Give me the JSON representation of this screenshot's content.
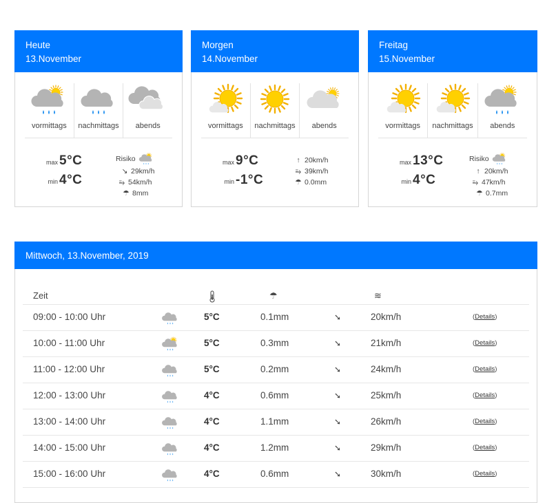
{
  "cards": [
    {
      "day": "Heute",
      "date": "13.November",
      "periods": [
        {
          "label": "vormittags",
          "icon": "cloud-sun-rain-icon"
        },
        {
          "label": "nachmittags",
          "icon": "cloud-rain-icon"
        },
        {
          "label": "abends",
          "icon": "clouds-icon"
        }
      ],
      "max_label": "max",
      "max": "5°C",
      "min_label": "min",
      "min": "4°C",
      "risk_label": "Risiko",
      "wind": "29km/h",
      "gusts": "54km/h",
      "precip": "8mm"
    },
    {
      "day": "Morgen",
      "date": "14.November",
      "periods": [
        {
          "label": "vormittags",
          "icon": "sun-cloud-icon"
        },
        {
          "label": "nachmittags",
          "icon": "sun-icon"
        },
        {
          "label": "abends",
          "icon": "cloud-sun-icon"
        }
      ],
      "max_label": "max",
      "max": "9°C",
      "min_label": "min",
      "min": "-1°C",
      "wind": "20km/h",
      "gusts": "39km/h",
      "precip": "0.0mm"
    },
    {
      "day": "Freitag",
      "date": "15.November",
      "periods": [
        {
          "label": "vormittags",
          "icon": "sun-cloud-icon"
        },
        {
          "label": "nachmittags",
          "icon": "sun-cloud-icon"
        },
        {
          "label": "abends",
          "icon": "cloud-sun-rain-icon"
        }
      ],
      "max_label": "max",
      "max": "13°C",
      "min_label": "min",
      "min": "4°C",
      "risk_label": "Risiko",
      "wind": "20km/h",
      "gusts": "47km/h",
      "precip": "0.7mm"
    }
  ],
  "hourly": {
    "title": "Mittwoch, 13.November, 2019",
    "col_time": "Zeit",
    "details_label": "Details",
    "rows": [
      {
        "time": "09:00 - 10:00 Uhr",
        "icon": "cloud-rain-icon",
        "temp": "5°C",
        "rain": "0.1mm",
        "wind": "20km/h"
      },
      {
        "time": "10:00 - 11:00 Uhr",
        "icon": "cloud-sun-rain-icon",
        "temp": "5°C",
        "rain": "0.3mm",
        "wind": "21km/h"
      },
      {
        "time": "11:00 - 12:00 Uhr",
        "icon": "cloud-rain-icon",
        "temp": "5°C",
        "rain": "0.2mm",
        "wind": "24km/h"
      },
      {
        "time": "12:00 - 13:00 Uhr",
        "icon": "cloud-rain-icon",
        "temp": "4°C",
        "rain": "0.6mm",
        "wind": "25km/h"
      },
      {
        "time": "13:00 - 14:00 Uhr",
        "icon": "cloud-rain-icon",
        "temp": "4°C",
        "rain": "1.1mm",
        "wind": "26km/h"
      },
      {
        "time": "14:00 - 15:00 Uhr",
        "icon": "cloud-rain-icon",
        "temp": "4°C",
        "rain": "1.2mm",
        "wind": "29km/h"
      },
      {
        "time": "15:00 - 16:00 Uhr",
        "icon": "cloud-rain-icon",
        "temp": "4°C",
        "rain": "0.6mm",
        "wind": "30km/h"
      }
    ]
  },
  "colors": {
    "header_blue": "#0078ff",
    "sun": "#ffc400",
    "cloud": "#b4b4b4",
    "rain": "#1e8ff0"
  }
}
